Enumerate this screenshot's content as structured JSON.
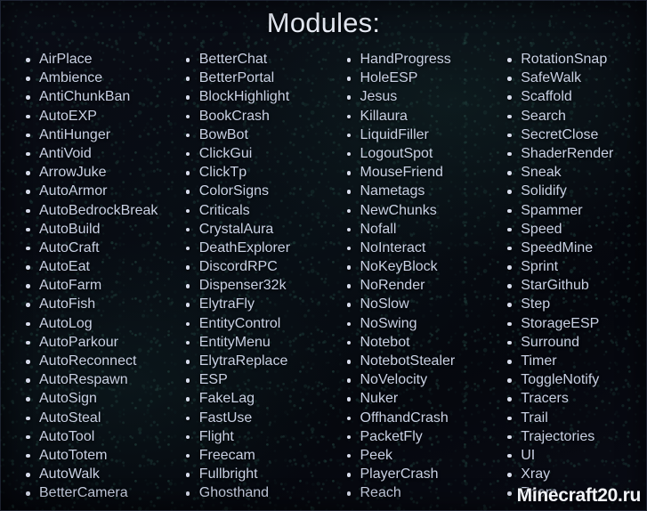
{
  "page": {
    "title": "Modules:",
    "background_color": "#080a12",
    "text_color": "#c9d1e4",
    "title_color": "#e8ecf6",
    "bullet_color": "#d7dcec",
    "border_color": "#7887b4"
  },
  "watermark": {
    "text": "Minecraft20.ru",
    "color": "#f2f4f8"
  },
  "columns": [
    {
      "id": "column-1",
      "items": [
        "AirPlace",
        "Ambience",
        "AntiChunkBan",
        "AutoEXP",
        "AntiHunger",
        "AntiVoid",
        "ArrowJuke",
        "AutoArmor",
        "AutoBedrockBreak",
        "AutoBuild",
        "AutoCraft",
        "AutoEat",
        "AutoFarm",
        "AutoFish",
        "AutoLog",
        "AutoParkour",
        "AutoReconnect",
        "AutoRespawn",
        "AutoSign",
        "AutoSteal",
        "AutoTool",
        "AutoTotem",
        "AutoWalk",
        "BetterCamera"
      ]
    },
    {
      "id": "column-2",
      "items": [
        "BetterChat",
        "BetterPortal",
        "BlockHighlight",
        "BookCrash",
        "BowBot",
        "ClickGui",
        "ClickTp",
        "ColorSigns",
        "Criticals",
        "CrystalAura",
        "DeathExplorer",
        "DiscordRPC",
        "Dispenser32k",
        "ElytraFly",
        "EntityControl",
        "EntityMenu",
        "ElytraReplace",
        "ESP",
        "FakeLag",
        "FastUse",
        "Flight",
        "Freecam",
        "Fullbright",
        "Ghosthand"
      ]
    },
    {
      "id": "column-3",
      "items": [
        "HandProgress",
        "HoleESP",
        "Jesus",
        "Killaura",
        "LiquidFiller",
        "LogoutSpot",
        "MouseFriend",
        "Nametags",
        "NewChunks",
        "Nofall",
        "NoInteract",
        "NoKeyBlock",
        "NoRender",
        "NoSlow",
        "NoSwing",
        "Notebot",
        "NotebotStealer",
        "NoVelocity",
        "Nuker",
        "OffhandCrash",
        "PacketFly",
        "Peek",
        "PlayerCrash",
        "Reach"
      ]
    },
    {
      "id": "column-4",
      "items": [
        "RotationSnap",
        "SafeWalk",
        "Scaffold",
        "Search",
        "SecretClose",
        "ShaderRender",
        "Sneak",
        "Solidify",
        "Spammer",
        "Speed",
        "SpeedMine",
        "Sprint",
        "StarGithub",
        "Step",
        "StorageESP",
        "Surround",
        "Timer",
        "ToggleNotify",
        "Tracers",
        "Trail",
        "Trajectories",
        "UI",
        "Xray",
        "Zoom"
      ]
    }
  ]
}
